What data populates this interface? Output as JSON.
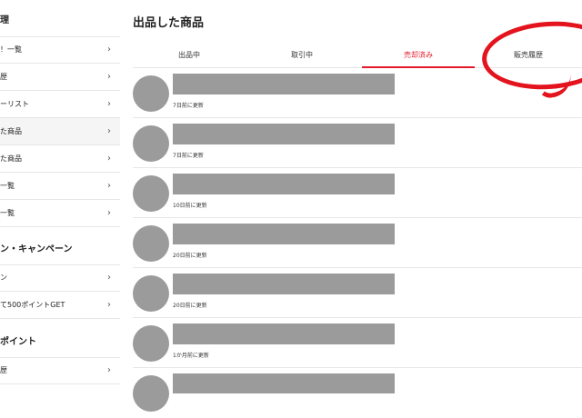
{
  "sidebar": {
    "top_heading": "理",
    "section_campaign": "ン・キャンペーン",
    "section_point": "ポイント",
    "items": [
      {
        "label": "！一覧"
      },
      {
        "label": "歴"
      },
      {
        "label": "ーリスト"
      },
      {
        "label": "た商品"
      },
      {
        "label": "た商品"
      },
      {
        "label": "一覧"
      },
      {
        "label": "一覧"
      },
      {
        "label": "ン"
      },
      {
        "label": "て500ポイントGET"
      },
      {
        "label": "歴"
      }
    ]
  },
  "main": {
    "title": "出品した商品",
    "tabs": [
      {
        "label": "出品中"
      },
      {
        "label": "取引中"
      },
      {
        "label": "売却済み"
      },
      {
        "label": "販売履歴"
      }
    ],
    "items": [
      {
        "updated": "7日前に更新"
      },
      {
        "updated": "7日前に更新"
      },
      {
        "updated": "10日前に更新"
      },
      {
        "updated": "20日前に更新"
      },
      {
        "updated": "20日前に更新"
      },
      {
        "updated": "1か月前に更新"
      },
      {
        "updated": ""
      }
    ]
  },
  "colors": {
    "accent": "#e21a2a",
    "annotation": "#e3141e",
    "redaction": "#9b9b9b"
  },
  "icons": {
    "sidebar_chevron": "chevron-right-icon"
  }
}
